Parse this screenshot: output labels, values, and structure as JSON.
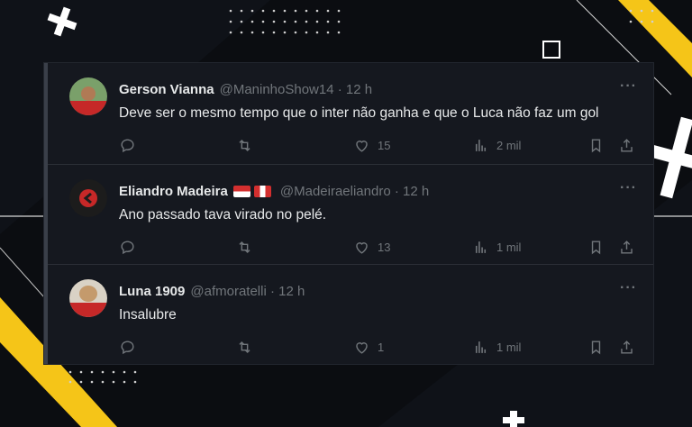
{
  "tweets": [
    {
      "name": "Gerson Vianna",
      "handle": "@ManinhoShow14",
      "time": "· 12 h",
      "text": "Deve ser o mesmo tempo que o inter não ganha e que o Luca não faz um gol",
      "likes": "15",
      "views": "2 mil",
      "flags": []
    },
    {
      "name": "Eliandro Madeira",
      "handle": "@Madeiraeliandro",
      "time": "· 12 h",
      "text": "Ano passado tava virado no pelé.",
      "likes": "13",
      "views": "1 mil",
      "flags": [
        "flag-red-white",
        "flag-peru"
      ]
    },
    {
      "name": "Luna 1909",
      "handle": "@afmoratelli",
      "time": "· 12 h",
      "text": "Insalubre",
      "likes": "1",
      "views": "1 mil",
      "flags": []
    }
  ],
  "more_glyph": "···",
  "colors": {
    "background": "#0b0d11",
    "panel": "#15181f",
    "accent_yellow": "#f5c518",
    "muted": "#71767b",
    "text": "#e7e9ea"
  }
}
